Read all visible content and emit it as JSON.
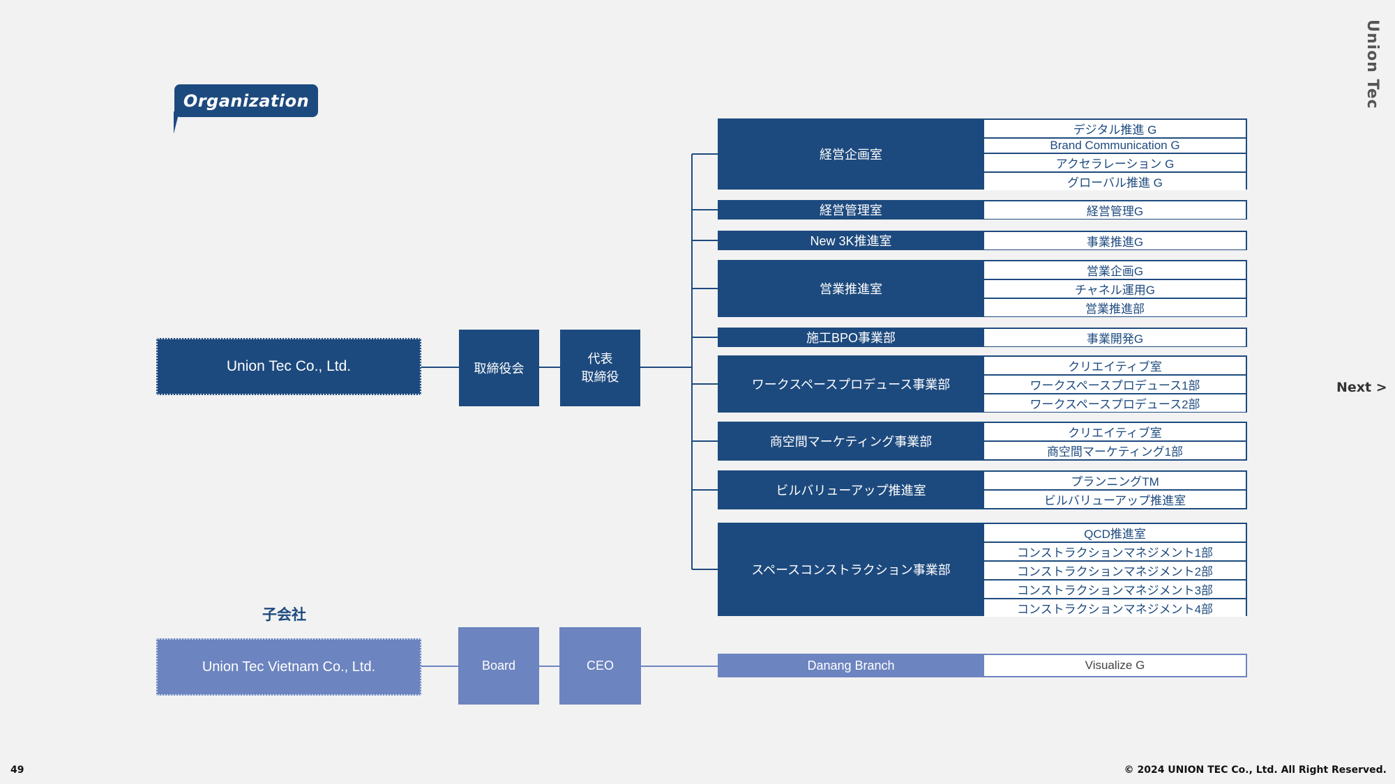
{
  "header": {
    "title": "Organization",
    "brand": "Union Tec",
    "next_label": "Next >"
  },
  "footer": {
    "page_number": "49",
    "copyright": "© 2024 UNION TEC Co., Ltd. All Right Reserved."
  },
  "colors": {
    "primary": "#1d4a7e",
    "subsidiary": "#6c84bf",
    "background": "#f2f2f2"
  },
  "parent": {
    "company": "Union Tec Co., Ltd.",
    "board": "取締役会",
    "ceo_line1": "代表",
    "ceo_line2": "取締役",
    "departments": [
      {
        "name": "経営企画室",
        "groups": [
          "デジタル推進 G",
          "Brand Communication G",
          "アクセラレーション G",
          "グローバル推進 G"
        ]
      },
      {
        "name": "経営管理室",
        "groups": [
          "経営管理G"
        ]
      },
      {
        "name": "New 3K推進室",
        "groups": [
          "事業推進G"
        ]
      },
      {
        "name": "営業推進室",
        "groups": [
          "営業企画G",
          "チャネル運用G",
          "営業推進部"
        ]
      },
      {
        "name": "施工BPO事業部",
        "groups": [
          "事業開発G"
        ]
      },
      {
        "name": "ワークスペースプロデュース事業部",
        "groups": [
          "クリエイティブ室",
          "ワークスペースプロデュース1部",
          "ワークスペースプロデュース2部"
        ]
      },
      {
        "name": "商空間マーケティング事業部",
        "groups": [
          "クリエイティブ室",
          "商空間マーケティング1部"
        ]
      },
      {
        "name": "ビルバリューアップ推進室",
        "groups": [
          "プランニングTM",
          "ビルバリューアップ推進室"
        ]
      },
      {
        "name": "スペースコンストラクション事業部",
        "groups": [
          "QCD推進室",
          "コンストラクションマネジメント1部",
          "コンストラクションマネジメント2部",
          "コンストラクションマネジメント3部",
          "コンストラクションマネジメント4部"
        ]
      }
    ]
  },
  "subsidiary": {
    "label": "子会社",
    "company": "Union Tec Vietnam Co., Ltd.",
    "board": "Board",
    "ceo": "CEO",
    "departments": [
      {
        "name": "Danang Branch",
        "groups": [
          "Visualize G"
        ]
      }
    ]
  }
}
